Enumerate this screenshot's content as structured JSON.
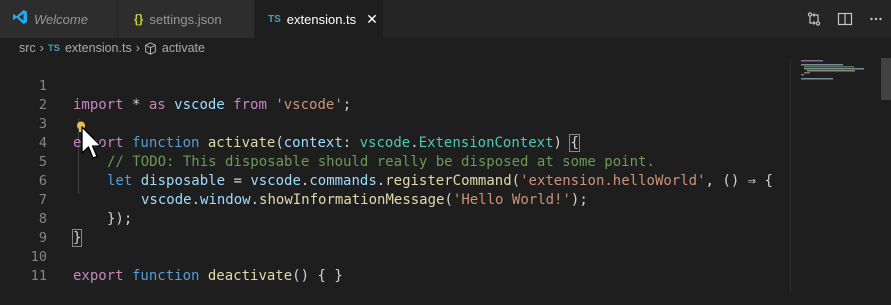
{
  "tabs": [
    {
      "icon": "vscode-icon",
      "label": "Welcome"
    },
    {
      "icon": "json-icon",
      "icon_glyph": "{}",
      "label": "settings.json"
    },
    {
      "icon": "typescript-icon",
      "icon_glyph": "TS",
      "label": "extension.ts",
      "close": "✕"
    }
  ],
  "breadcrumb": {
    "folder": "src",
    "file_icon": "TS",
    "file": "extension.ts",
    "symbol": "activate"
  },
  "editor": {
    "line_numbers": [
      "1",
      "2",
      "3",
      "4",
      "5",
      "6",
      "7",
      "8",
      "9",
      "10",
      "11"
    ],
    "code": {
      "l1": {
        "kw1": "import",
        "star": " * ",
        "kw2": "as",
        "id": " vscode ",
        "kw3": "from",
        "str": " 'vscode'",
        "end": ";"
      },
      "l3": {
        "kw": "export",
        "kw2": " function ",
        "fn": "activate",
        "p1": "(",
        "param": "context",
        "colon": ": ",
        "ns": "vscode",
        "dot": ".",
        "type": "ExtensionContext",
        "p2": ") ",
        "brace": "{"
      },
      "l4": {
        "comment": "// TODO: This disposable should really be disposed at some point."
      },
      "l5": {
        "kw": "let",
        "sp": " ",
        "var": "disposable",
        "eq": " = ",
        "ns": "vscode",
        "d1": ".",
        "prop": "commands",
        "d2": ".",
        "fn": "registerCommand",
        "p": "(",
        "str": "'extension.helloWorld'",
        "rest": ", () ⇒ {"
      },
      "l6": {
        "ns": "vscode",
        "d1": ".",
        "prop": "window",
        "d2": ".",
        "fn": "showInformationMessage",
        "p": "(",
        "str": "'Hello World!'",
        "end": ");"
      },
      "l7": {
        "text": "});"
      },
      "l8": {
        "brace": "}"
      },
      "l10": {
        "kw": "export",
        "kw2": " function ",
        "fn": "deactivate",
        "rest": "() { }"
      }
    }
  },
  "colors": {
    "background": "#1e1e1e",
    "keyword": "#569cd6",
    "string": "#ce9178",
    "comment": "#6a9955",
    "function": "#dcdcaa",
    "variable": "#9cdcfe",
    "type": "#4ec9b0",
    "lightbulb": "#e0c050"
  }
}
